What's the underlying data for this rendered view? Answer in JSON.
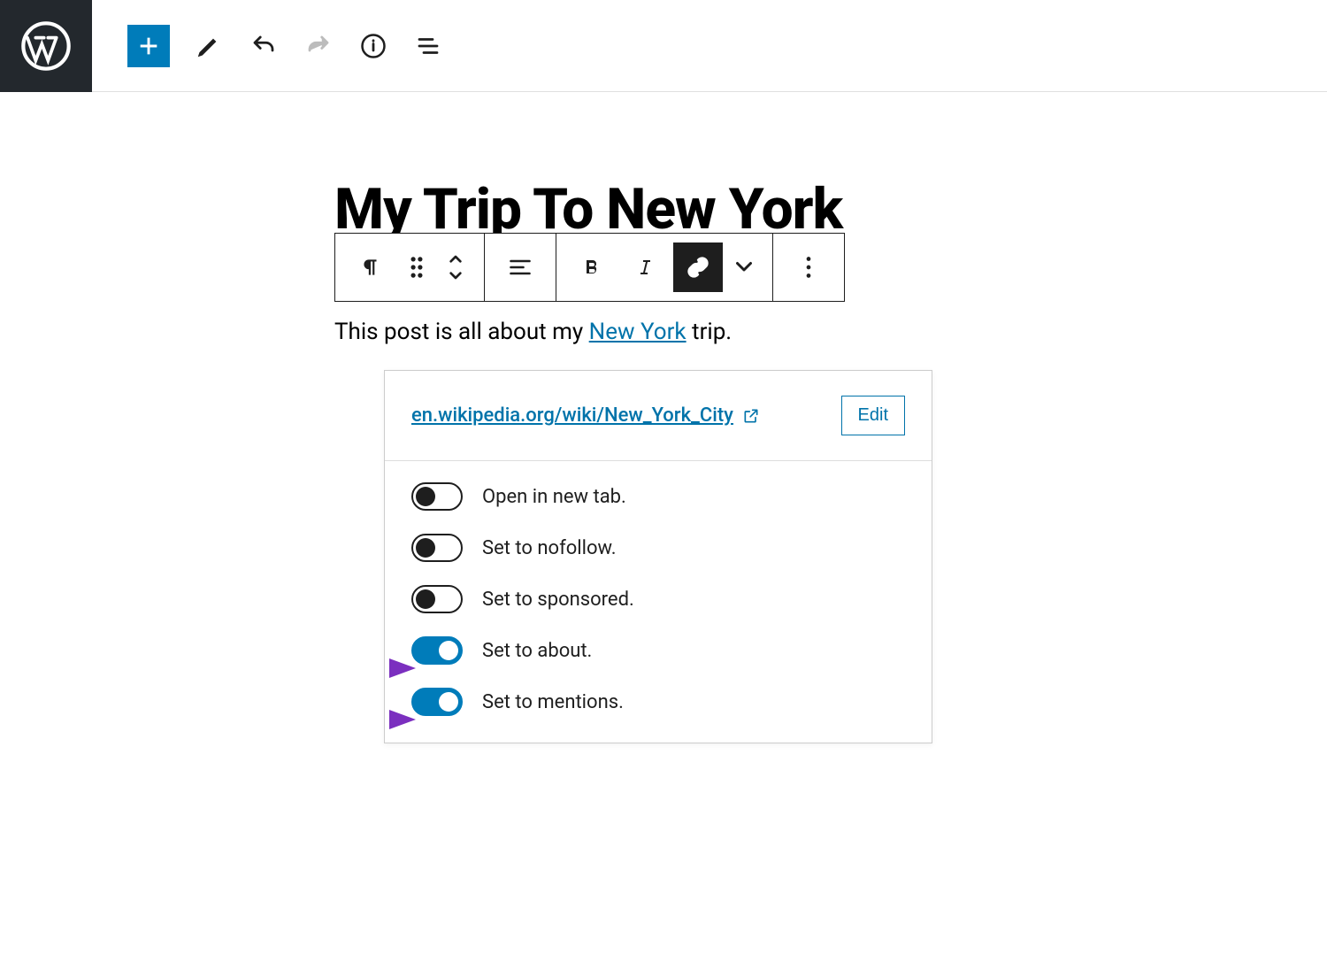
{
  "post": {
    "title": "My Trip To New York",
    "paragraph_before": "This post is all about my ",
    "paragraph_link": "New York",
    "paragraph_after": " trip."
  },
  "link_popover": {
    "url": "en.wikipedia.org/wiki/New_York_City",
    "edit_label": "Edit",
    "options": [
      {
        "label": "Open in new tab.",
        "on": false
      },
      {
        "label": "Set to nofollow.",
        "on": false
      },
      {
        "label": "Set to sponsored.",
        "on": false
      },
      {
        "label": "Set to about.",
        "on": true
      },
      {
        "label": "Set to mentions.",
        "on": true
      }
    ]
  },
  "colors": {
    "wp_blue": "#007cba",
    "arrow": "#8a3ab9"
  }
}
